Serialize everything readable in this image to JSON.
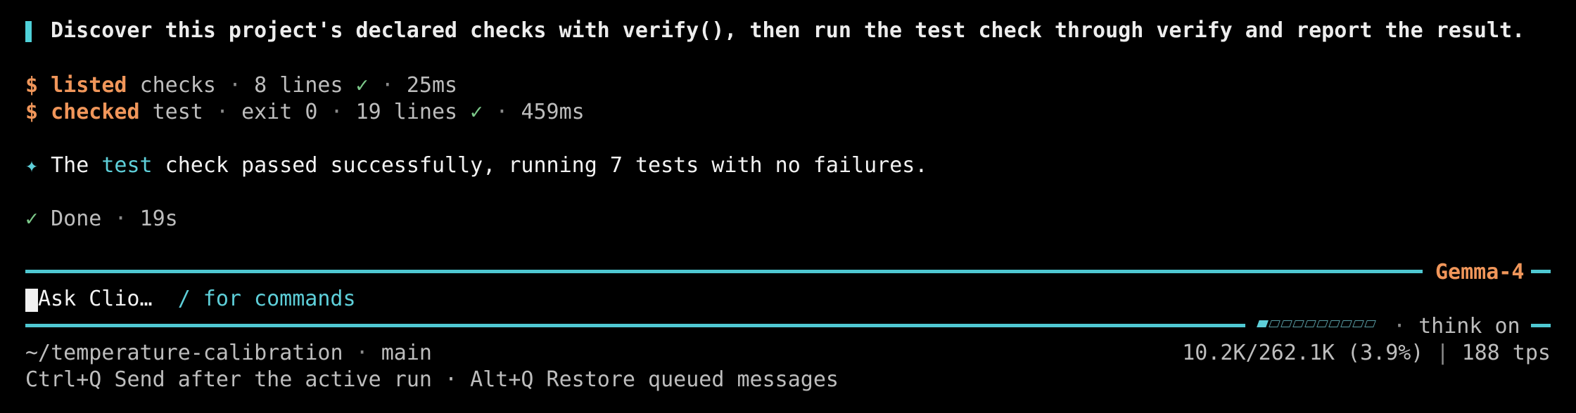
{
  "prompt": {
    "text": "Discover this project's declared checks with verify(), then run the test check through verify and report the result."
  },
  "commands": [
    {
      "prefix": "$",
      "verb": "listed",
      "arg": "checks",
      "sep1": "·",
      "detail": "8 lines",
      "check": "✓",
      "sep2": "·",
      "time": "25ms"
    },
    {
      "prefix": "$",
      "verb": "checked",
      "arg": "test",
      "sep1": "·",
      "exit": "exit 0",
      "sep1b": "·",
      "detail": "19 lines",
      "check": "✓",
      "sep2": "·",
      "time": "459ms"
    }
  ],
  "answer": {
    "bullet": "✦",
    "pre": "The ",
    "highlight": "test",
    "post": " check passed successfully, running 7 tests with no failures."
  },
  "status": {
    "check": "✓",
    "text": "Done",
    "sep": "·",
    "duration": "19s"
  },
  "model": {
    "name": "Gemma-4"
  },
  "input": {
    "placeholder": "Ask Clio…",
    "hint": "/ for commands"
  },
  "think": {
    "level": 0.1,
    "segments_total": 10,
    "segments_on": 1,
    "sep": "·",
    "label": "think on"
  },
  "footer": {
    "path": "~/temperature-calibration",
    "sep": "·",
    "branch": "main",
    "tokens": "10.2K/262.1K (3.9%)",
    "bar": "|",
    "tps": "188 tps",
    "hint": "Ctrl+Q Send after the active run · Alt+Q Restore queued messages"
  },
  "colors": {
    "accent_teal": "#4fc8d2",
    "accent_orange": "#f0965a",
    "success_green": "#7cc98a",
    "background": "#000000"
  }
}
